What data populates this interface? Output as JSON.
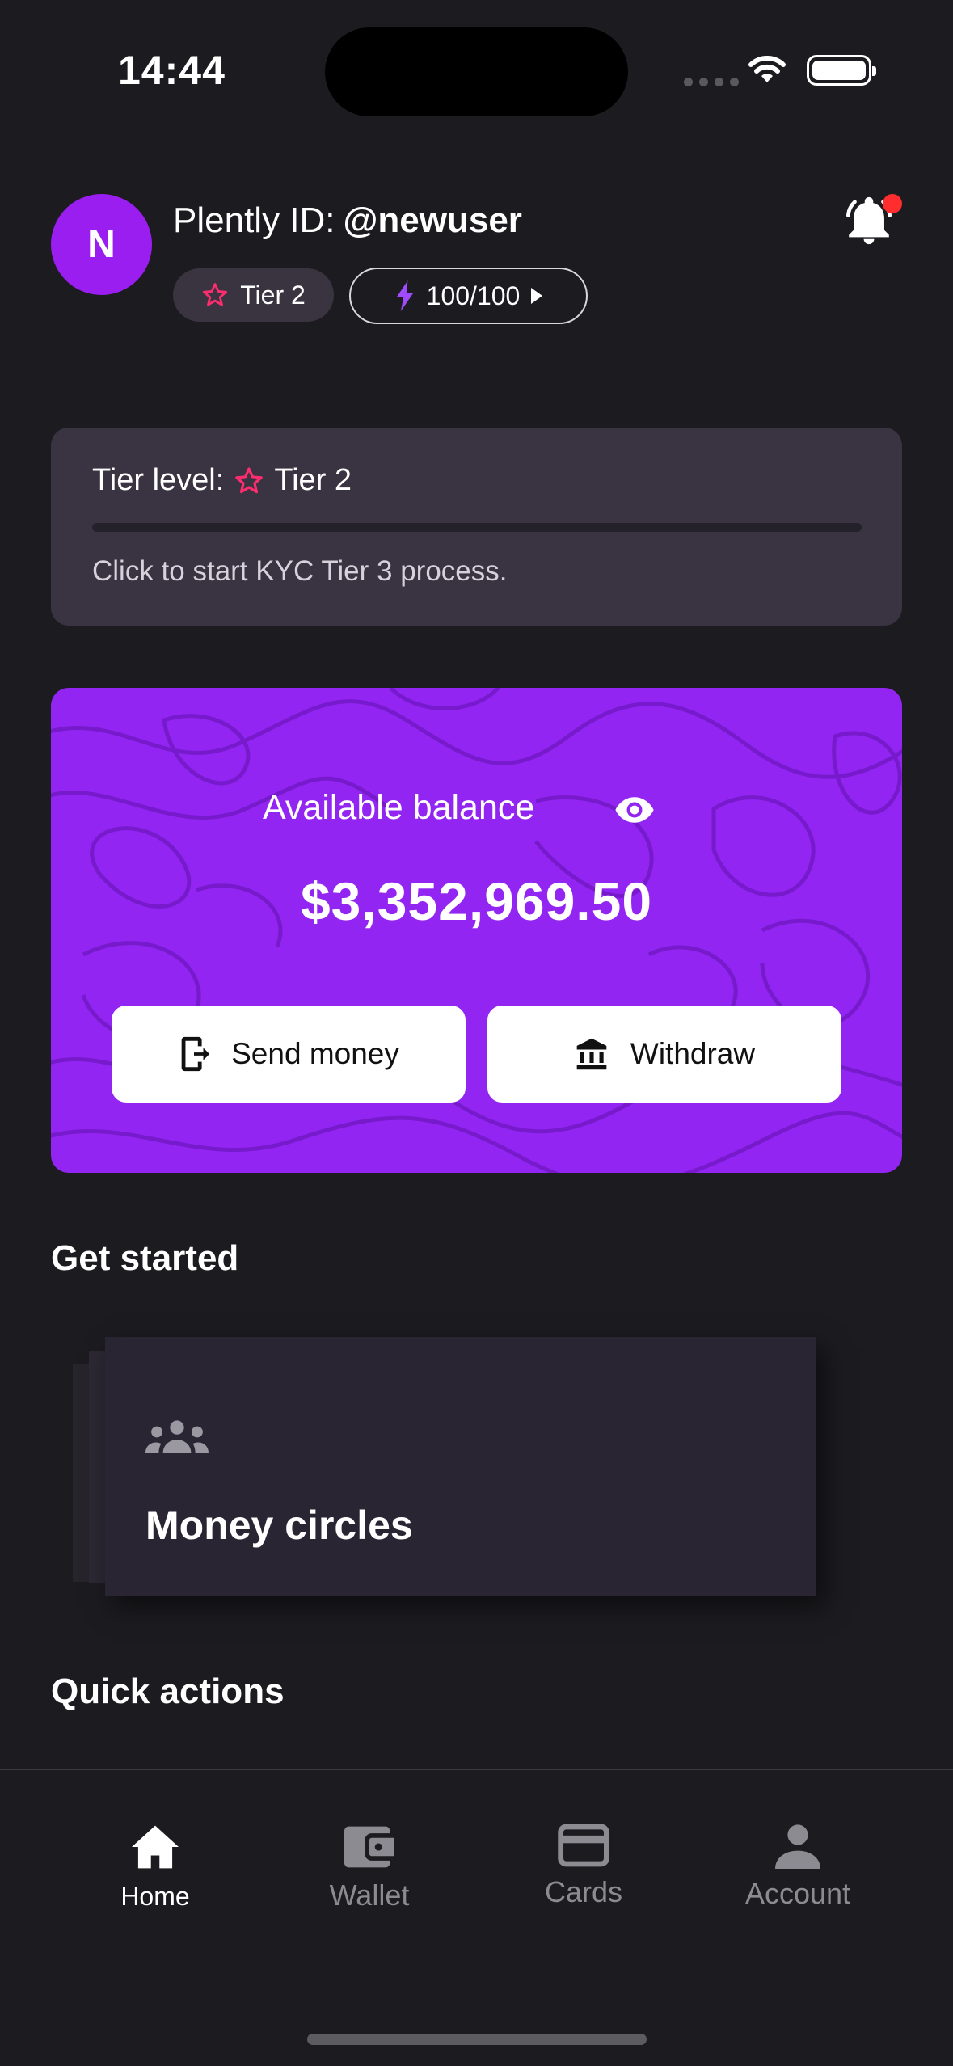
{
  "status_bar": {
    "time": "14:44"
  },
  "header": {
    "avatar_initial": "N",
    "id_prefix": "Plently ID:",
    "handle": "@newuser",
    "tier_badge": "Tier 2",
    "energy": "100/100"
  },
  "tier_card": {
    "label": "Tier level:",
    "tier": "Tier 2",
    "hint": "Click to start KYC Tier 3 process."
  },
  "balance": {
    "label": "Available balance",
    "amount": "$3,352,969.50",
    "send_label": "Send money",
    "withdraw_label": "Withdraw"
  },
  "get_started": {
    "title": "Get started",
    "card_title": "Money circles"
  },
  "quick_actions": {
    "title": "Quick actions"
  },
  "nav": {
    "items": [
      {
        "label": "Home",
        "icon": "home-icon",
        "active": true
      },
      {
        "label": "Wallet",
        "icon": "wallet-icon",
        "active": false
      },
      {
        "label": "Cards",
        "icon": "card-icon",
        "active": false
      },
      {
        "label": "Account",
        "icon": "person-icon",
        "active": false
      }
    ]
  },
  "colors": {
    "background": "#1c1b1f",
    "accent_purple": "#9325f2",
    "avatar_purple": "#9a1ef0",
    "star_pink": "#ff2d6f",
    "notification_red": "#ff2d2d"
  }
}
